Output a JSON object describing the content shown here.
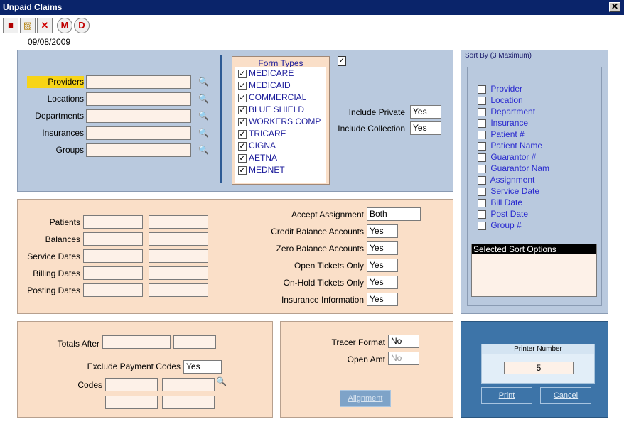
{
  "window": {
    "title": "Unpaid Claims",
    "close_label": "✕"
  },
  "toolbar": {
    "buttons": [
      {
        "name": "print-report-icon",
        "glyph": "■"
      },
      {
        "name": "open-folder-icon",
        "glyph": "▧"
      },
      {
        "name": "delete-x-icon",
        "glyph": "✕"
      },
      {
        "name": "m-circle-icon",
        "glyph": "M"
      },
      {
        "name": "d-circle-icon",
        "glyph": "D"
      }
    ]
  },
  "date": "09/08/2009",
  "filters": {
    "providers_label": "Providers",
    "locations_label": "Locations",
    "departments_label": "Departments",
    "insurances_label": "Insurances",
    "groups_label": "Groups"
  },
  "form_types": {
    "title": "Form Types",
    "items": [
      "MEDICARE",
      "MEDICAID",
      "COMMERCIAL",
      "BLUE SHIELD",
      "WORKERS COMP",
      "TRICARE",
      "CIGNA",
      "AETNA",
      "MEDNET"
    ],
    "checked": [
      true,
      true,
      true,
      true,
      true,
      true,
      true,
      true,
      true
    ]
  },
  "include": {
    "private_label": "Include Private",
    "private_value": "Yes",
    "collection_label": "Include Collection",
    "collection_value": "Yes"
  },
  "sort_by": {
    "title": "Sort By (3 Maximum)",
    "items": [
      "Provider",
      "Location",
      "Department",
      "Insurance",
      "Patient #",
      "Patient Name",
      "Guarantor #",
      "Guarantor Nam",
      "Assignment",
      "Service Date",
      "Bill Date",
      "Post Date",
      "Group #"
    ],
    "selected_title": "Selected Sort Options"
  },
  "ranges": {
    "patients_label": "Patients",
    "balances_label": "Balances",
    "service_dates_label": "Service Dates",
    "billing_dates_label": "Billing Dates",
    "posting_dates_label": "Posting Dates"
  },
  "options": {
    "accept_assignment_label": "Accept Assignment",
    "accept_assignment_value": "Both",
    "credit_balance_label": "Credit Balance Accounts",
    "credit_balance_value": "Yes",
    "zero_balance_label": "Zero Balance Accounts",
    "zero_balance_value": "Yes",
    "open_tickets_label": "Open Tickets Only",
    "open_tickets_value": "Yes",
    "onhold_tickets_label": "On-Hold Tickets Only",
    "onhold_tickets_value": "Yes",
    "insurance_info_label": "Insurance Information",
    "insurance_info_value": "Yes"
  },
  "totals": {
    "totals_after_label": "Totals After",
    "exclude_payment_codes_label": "Exclude Payment Codes",
    "exclude_payment_codes_value": "Yes",
    "codes_label": "Codes"
  },
  "tracer": {
    "tracer_format_label": "Tracer Format",
    "tracer_format_value": "No",
    "open_amt_label": "Open Amt",
    "open_amt_value": "No",
    "alignment_label": "Alignment"
  },
  "printer": {
    "title": "Printer Number",
    "value": "5",
    "print_label": "Print",
    "cancel_label": "Cancel"
  }
}
